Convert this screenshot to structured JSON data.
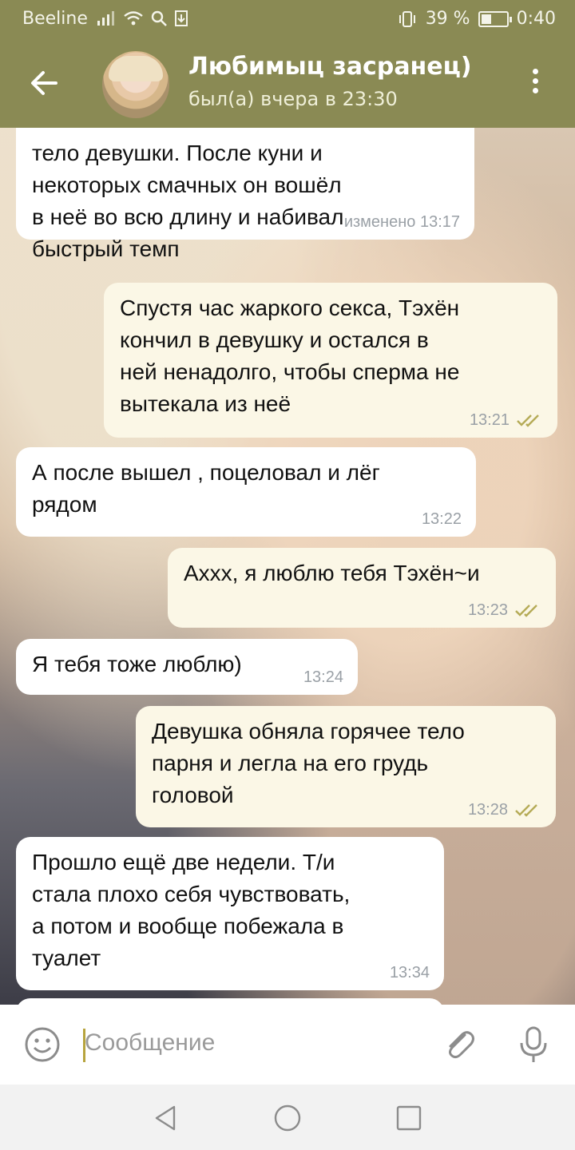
{
  "status_bar": {
    "carrier": "Beeline",
    "battery_text": "39 %",
    "battery_level": 0.39,
    "time": "0:40"
  },
  "header": {
    "title": "Любимыц засранец)",
    "subtitle": "был(а) вчера в 23:30"
  },
  "messages": [
    {
      "side": "in",
      "lines": [
        "тело девушки. После куни и",
        "некоторых смачных он вошёл",
        "в неё во всю длину и набивал",
        "быстрый темп"
      ],
      "time": "изменено 13:17",
      "read": false
    },
    {
      "side": "out",
      "lines": [
        "Спустя час жаркого секса, Тэхён",
        "кончил в девушку и остался в",
        "ней ненадолго, чтобы сперма не",
        "вытекала из неё"
      ],
      "time": "13:21",
      "read": true
    },
    {
      "side": "in",
      "lines": [
        "А после вышел , поцеловал и лёг",
        "рядом"
      ],
      "time": "13:22",
      "read": false
    },
    {
      "side": "out",
      "lines": [
        "Ахxх, я люблю тебя Тэхён~и"
      ],
      "time": "13:23",
      "read": true
    },
    {
      "side": "in",
      "lines": [
        "Я тебя тоже люблю)"
      ],
      "time": "13:24",
      "read": false
    },
    {
      "side": "out",
      "lines": [
        "Девушка обняла горячее тело",
        "парня и легла на его грудь",
        "головой"
      ],
      "time": "13:28",
      "read": true
    },
    {
      "side": "in",
      "lines": [
        "Прошло ещё две недели. Т/и",
        "стала плохо себя чувствовать,",
        "а потом и вообще побежала в",
        "туалет"
      ],
      "time": "13:34",
      "read": false
    }
  ],
  "composer": {
    "placeholder": "Сообщение"
  },
  "icons": {
    "back": "arrow-left-icon",
    "menu": "more-vert-icon",
    "emoji": "smile-icon",
    "attach": "paperclip-icon",
    "mic": "microphone-icon",
    "scroll": "chevron-down-icon"
  }
}
